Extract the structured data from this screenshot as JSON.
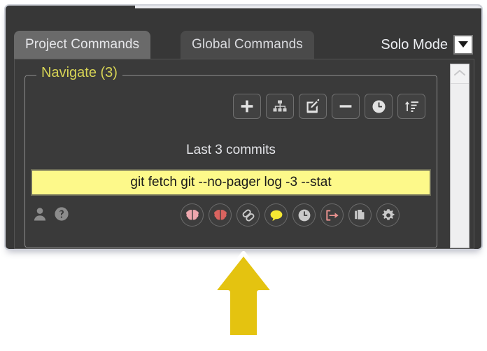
{
  "window": {
    "tabs": [
      {
        "label": "Project Commands",
        "active": true
      },
      {
        "label": "Global Commands",
        "active": false
      }
    ],
    "mode_selector": {
      "label": "Solo Mode",
      "icon": "chevron-down-icon"
    }
  },
  "group": {
    "title": "Navigate (3)",
    "title_color": "#d7d455"
  },
  "toolbar": {
    "buttons": [
      {
        "name": "add-command-button",
        "icon": "plus-icon"
      },
      {
        "name": "group-tree-button",
        "icon": "sitemap-icon"
      },
      {
        "name": "edit-command-button",
        "icon": "edit-pencil-icon"
      },
      {
        "name": "remove-command-button",
        "icon": "minus-icon"
      },
      {
        "name": "history-button",
        "icon": "clock-icon"
      },
      {
        "name": "sort-button",
        "icon": "sort-ascending-icon"
      }
    ]
  },
  "command": {
    "caption": "Last 3 commits",
    "text": "git fetch git --no-pager log -3 --stat",
    "field_bg": "#fdf98a"
  },
  "action_row": {
    "left": [
      {
        "name": "user-icon",
        "icon": "user-icon",
        "color": "#8c8c8c"
      },
      {
        "name": "help-icon",
        "icon": "question-circle-icon",
        "color": "#8c8c8c"
      }
    ],
    "right": [
      {
        "name": "brain-light-button",
        "icon": "brain-icon",
        "color": "#eda7ae"
      },
      {
        "name": "brain-active-button",
        "icon": "brain-icon",
        "color": "#d9635f"
      },
      {
        "name": "link-button",
        "icon": "link-chain-icon",
        "color": "#c9c9c9"
      },
      {
        "name": "comment-button",
        "icon": "speech-bubble-icon",
        "color": "#f5e733"
      },
      {
        "name": "schedule-button",
        "icon": "clock-icon",
        "color": "#c9c9c9"
      },
      {
        "name": "share-button",
        "icon": "share-export-icon",
        "color": "#e8918e"
      },
      {
        "name": "duplicate-button",
        "icon": "copy-icon",
        "color": "#c9c9c9"
      },
      {
        "name": "settings-button",
        "icon": "gear-icon",
        "color": "#c9c9c9"
      }
    ]
  },
  "scrollbar": {
    "up_icon": "chevron-up-icon"
  },
  "annotation": {
    "arrow": "up-arrow-annotation",
    "fill": "#e4c310",
    "stroke": "#ffffff"
  }
}
